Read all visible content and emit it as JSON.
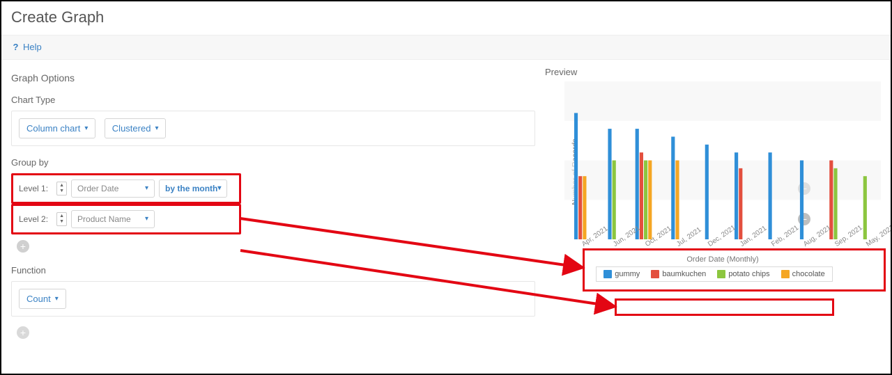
{
  "title": "Create Graph",
  "help": {
    "label": "Help"
  },
  "left": {
    "section_title": "Graph Options",
    "chart_type_label": "Chart Type",
    "chart_type_value": "Column chart",
    "chart_mode_value": "Clustered",
    "group_by_label": "Group by",
    "level1_label": "Level 1:",
    "level1_field": "Order Date",
    "level1_granularity": "by the month",
    "level2_label": "Level 2:",
    "level2_field": "Product Name",
    "function_label": "Function",
    "function_value": "Count"
  },
  "preview_label": "Preview",
  "chart_data": {
    "type": "bar",
    "title": "",
    "xlabel": "Order Date (Monthly)",
    "ylabel": "Number of Records",
    "ylim": [
      0,
      20
    ],
    "yticks": [
      5,
      10,
      15,
      20
    ],
    "categories": [
      "Apr, 2021",
      "Jun, 2021",
      "Oct, 2021",
      "Jul, 2021",
      "Dec, 2021",
      "Jan, 2021",
      "Feb, 2021",
      "Aug, 2021",
      "Sep, 2021",
      "May, 2021"
    ],
    "series": [
      {
        "name": "gummy",
        "color": "#2f8fd8",
        "values": [
          16,
          14,
          14,
          13,
          12,
          11,
          11,
          10,
          null,
          null
        ]
      },
      {
        "name": "baumkuchen",
        "color": "#e34f3e",
        "values": [
          8,
          null,
          11,
          null,
          null,
          9,
          null,
          null,
          10,
          null
        ]
      },
      {
        "name": "potato chips",
        "color": "#8cc63f",
        "values": [
          null,
          10,
          10,
          null,
          null,
          null,
          null,
          null,
          9,
          8
        ]
      },
      {
        "name": "chocolate",
        "color": "#f5a623",
        "values": [
          8,
          null,
          10,
          10,
          null,
          null,
          null,
          null,
          null,
          null
        ]
      }
    ]
  }
}
